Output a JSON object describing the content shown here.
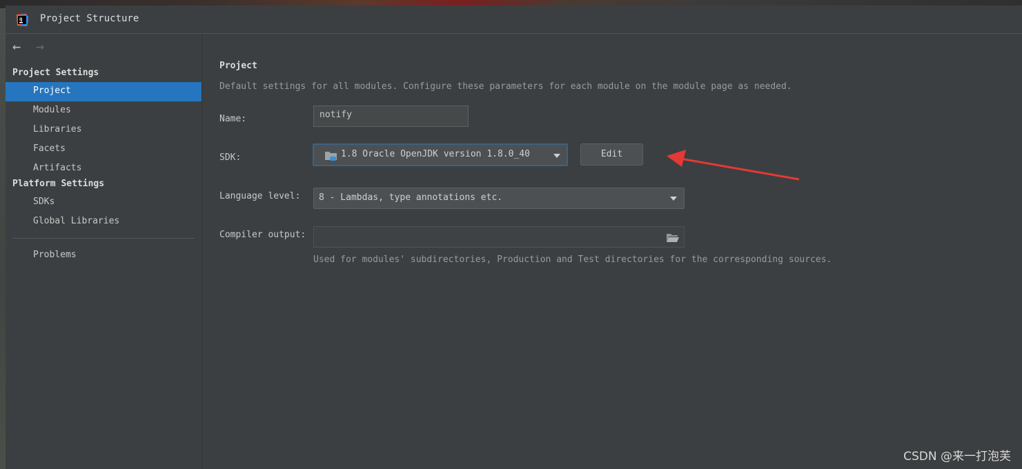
{
  "window": {
    "title": "Project Structure",
    "app_icon": "intellij-idea-icon"
  },
  "sidebar": {
    "back_icon": "arrow-left-icon",
    "forward_icon": "arrow-right-icon",
    "project_settings_header": "Project Settings",
    "project_settings_items": [
      {
        "label": "Project",
        "selected": true
      },
      {
        "label": "Modules"
      },
      {
        "label": "Libraries"
      },
      {
        "label": "Facets"
      },
      {
        "label": "Artifacts"
      }
    ],
    "platform_settings_header": "Platform Settings",
    "platform_settings_items": [
      {
        "label": "SDKs"
      },
      {
        "label": "Global Libraries"
      }
    ],
    "problems_label": "Problems"
  },
  "main": {
    "heading": "Project",
    "description": "Default settings for all modules. Configure these parameters for each module on the module page as needed.",
    "name_label": "Name:",
    "name_value": "notify",
    "sdk_label": "SDK:",
    "sdk_value": "1.8 Oracle OpenJDK version 1.8.0_40",
    "sdk_icon": "folder-jdk-icon",
    "edit_button": "Edit",
    "language_level_label": "Language level:",
    "language_level_value": "8 - Lambdas, type annotations etc.",
    "compiler_output_label": "Compiler output:",
    "compiler_output_value": "",
    "compiler_output_icon": "folder-open-icon",
    "compiler_output_hint": "Used for modules' subdirectories, Production and Test directories for the corresponding sources."
  },
  "colors": {
    "background": "#3c3f41",
    "selection": "#2675bf",
    "annotation_arrow": "#e53935"
  },
  "watermark": "CSDN @来一打泡芙"
}
